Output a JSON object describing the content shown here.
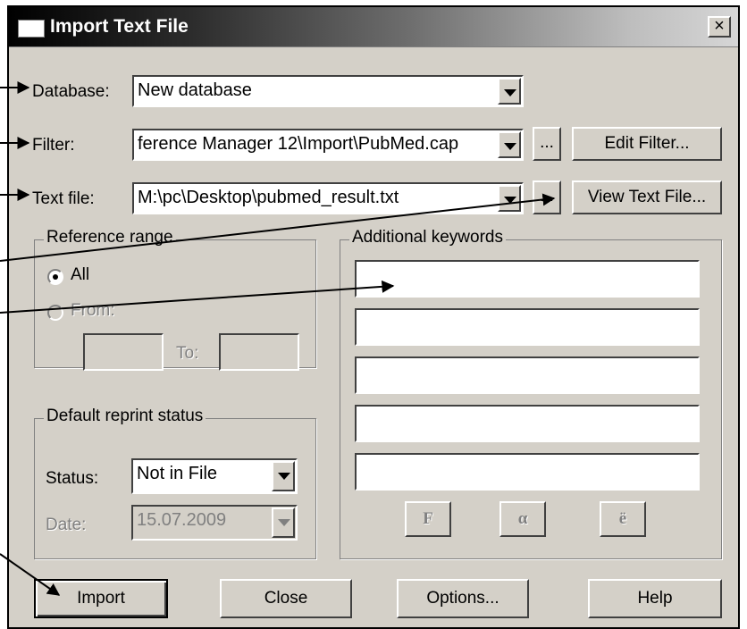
{
  "window": {
    "title": "Import Text File",
    "close_label": "×"
  },
  "database": {
    "label": "Database:",
    "value": "New database"
  },
  "filter": {
    "label": "Filter:",
    "value": "ference Manager 12\\Import\\PubMed.cap",
    "browse_label": "...",
    "edit_label": "Edit Filter..."
  },
  "textfile": {
    "label": "Text file:",
    "value": "M:\\pc\\Desktop\\pubmed_result.txt",
    "browse_label": "...",
    "view_label": "View Text File..."
  },
  "range": {
    "legend": "Reference range",
    "all_label": "All",
    "from_label": "From:",
    "to_label": "To:",
    "from_value": "",
    "to_value": ""
  },
  "keywords": {
    "legend": "Additional keywords",
    "values": [
      "",
      "",
      "",
      "",
      ""
    ],
    "buttons": [
      "F",
      "α",
      "ë"
    ]
  },
  "reprint": {
    "legend": "Default reprint status",
    "status_label": "Status:",
    "status_value": "Not in File",
    "date_label": "Date:",
    "date_value": "15.07.2009"
  },
  "buttons": {
    "import": "Import",
    "close": "Close",
    "options": "Options...",
    "help": "Help"
  },
  "colors": {
    "face": "#d4d0c8",
    "shadow": "#404040",
    "highlight": "#ffffff",
    "disabled_text": "#808080"
  }
}
